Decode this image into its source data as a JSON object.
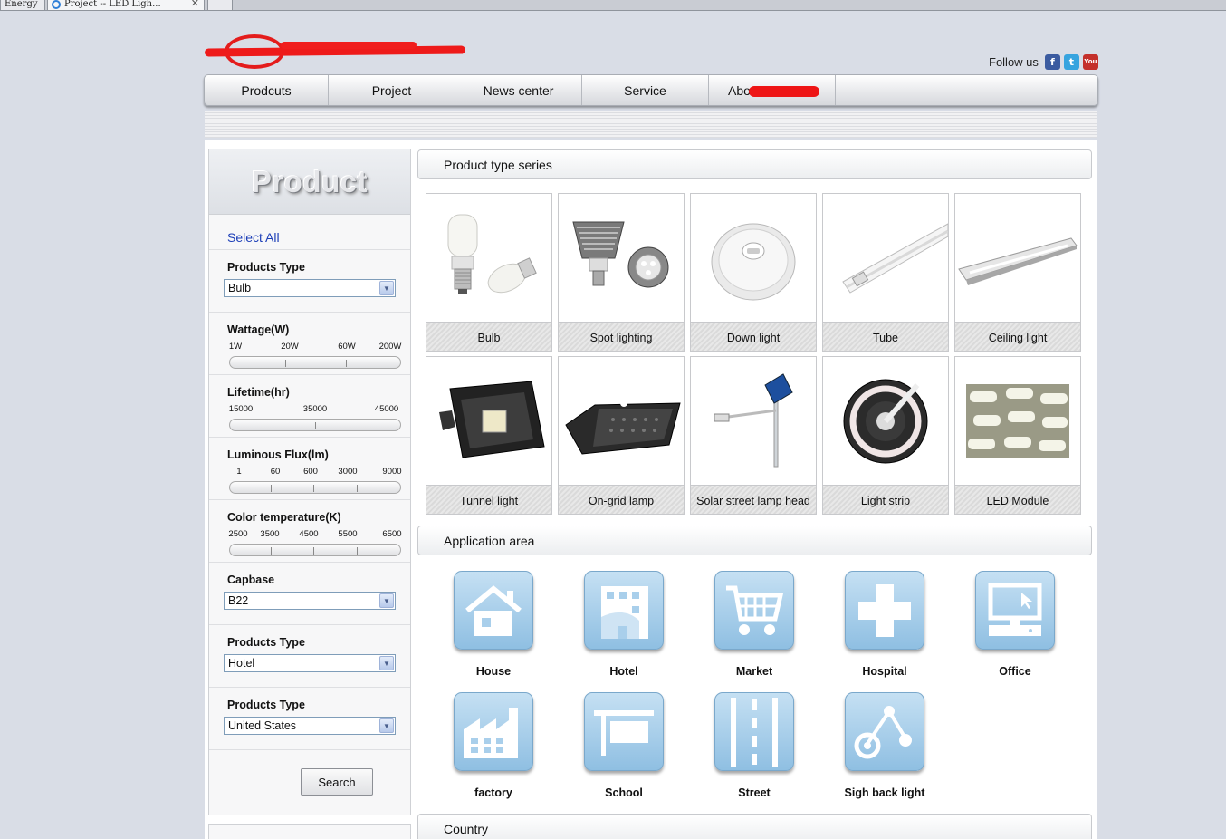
{
  "browser": {
    "tabs": [
      {
        "label": "Energy"
      },
      {
        "label": "Project -- LED Ligh..."
      },
      {
        "label": ""
      }
    ]
  },
  "header": {
    "follow_label": "Follow us",
    "social": [
      {
        "name": "facebook-icon",
        "glyph": "f"
      },
      {
        "name": "twitter-icon",
        "glyph": "t"
      },
      {
        "name": "youtube-icon",
        "glyph": "You"
      }
    ]
  },
  "nav": {
    "items": [
      {
        "label": "Prodcuts"
      },
      {
        "label": "Project"
      },
      {
        "label": "News center"
      },
      {
        "label": "Service"
      },
      {
        "label": "Abou"
      }
    ]
  },
  "sidebar": {
    "title": "Product",
    "select_all": "Select All",
    "products_type": {
      "label": "Products Type",
      "value": "Bulb"
    },
    "wattage": {
      "label": "Wattage(W)",
      "ticks": [
        "1W",
        "20W",
        "60W",
        "200W"
      ]
    },
    "lifetime": {
      "label": "Lifetime(hr)",
      "ticks": [
        "15000",
        "35000",
        "45000"
      ]
    },
    "flux": {
      "label": "Luminous Flux(lm)",
      "ticks": [
        "1",
        "60",
        "600",
        "3000",
        "9000"
      ]
    },
    "color_temp": {
      "label": "Color temperature(K)",
      "ticks": [
        "2500",
        "3500",
        "4500",
        "5500",
        "6500"
      ]
    },
    "capbase": {
      "label": "Capbase",
      "value": "B22"
    },
    "products_type_2": {
      "label": "Products Type",
      "value": "Hotel"
    },
    "products_type_3": {
      "label": "Products Type",
      "value": "United States"
    },
    "search_label": "Search"
  },
  "products": {
    "header": "Product type series",
    "items": [
      {
        "label": "Bulb"
      },
      {
        "label": "Spot lighting"
      },
      {
        "label": "Down light"
      },
      {
        "label": "Tube"
      },
      {
        "label": "Ceiling light"
      },
      {
        "label": "Tunnel light"
      },
      {
        "label": "On-grid lamp"
      },
      {
        "label": "Solar street lamp head"
      },
      {
        "label": "Light strip"
      },
      {
        "label": "LED Module"
      }
    ]
  },
  "application": {
    "header": "Application area",
    "items": [
      {
        "label": "House"
      },
      {
        "label": "Hotel"
      },
      {
        "label": "Market"
      },
      {
        "label": "Hospital"
      },
      {
        "label": "Office"
      },
      {
        "label": "factory"
      },
      {
        "label": "School"
      },
      {
        "label": "Street"
      },
      {
        "label": "Sigh back light"
      }
    ]
  },
  "country": {
    "header": "Country"
  },
  "colors": {
    "accent_link": "#1d3fb8",
    "app_icon": "#8fbfe2",
    "redaction": "#ee1a1a",
    "facebook": "#3b5ba0",
    "twitter": "#37a4df",
    "youtube": "#c4302b"
  }
}
